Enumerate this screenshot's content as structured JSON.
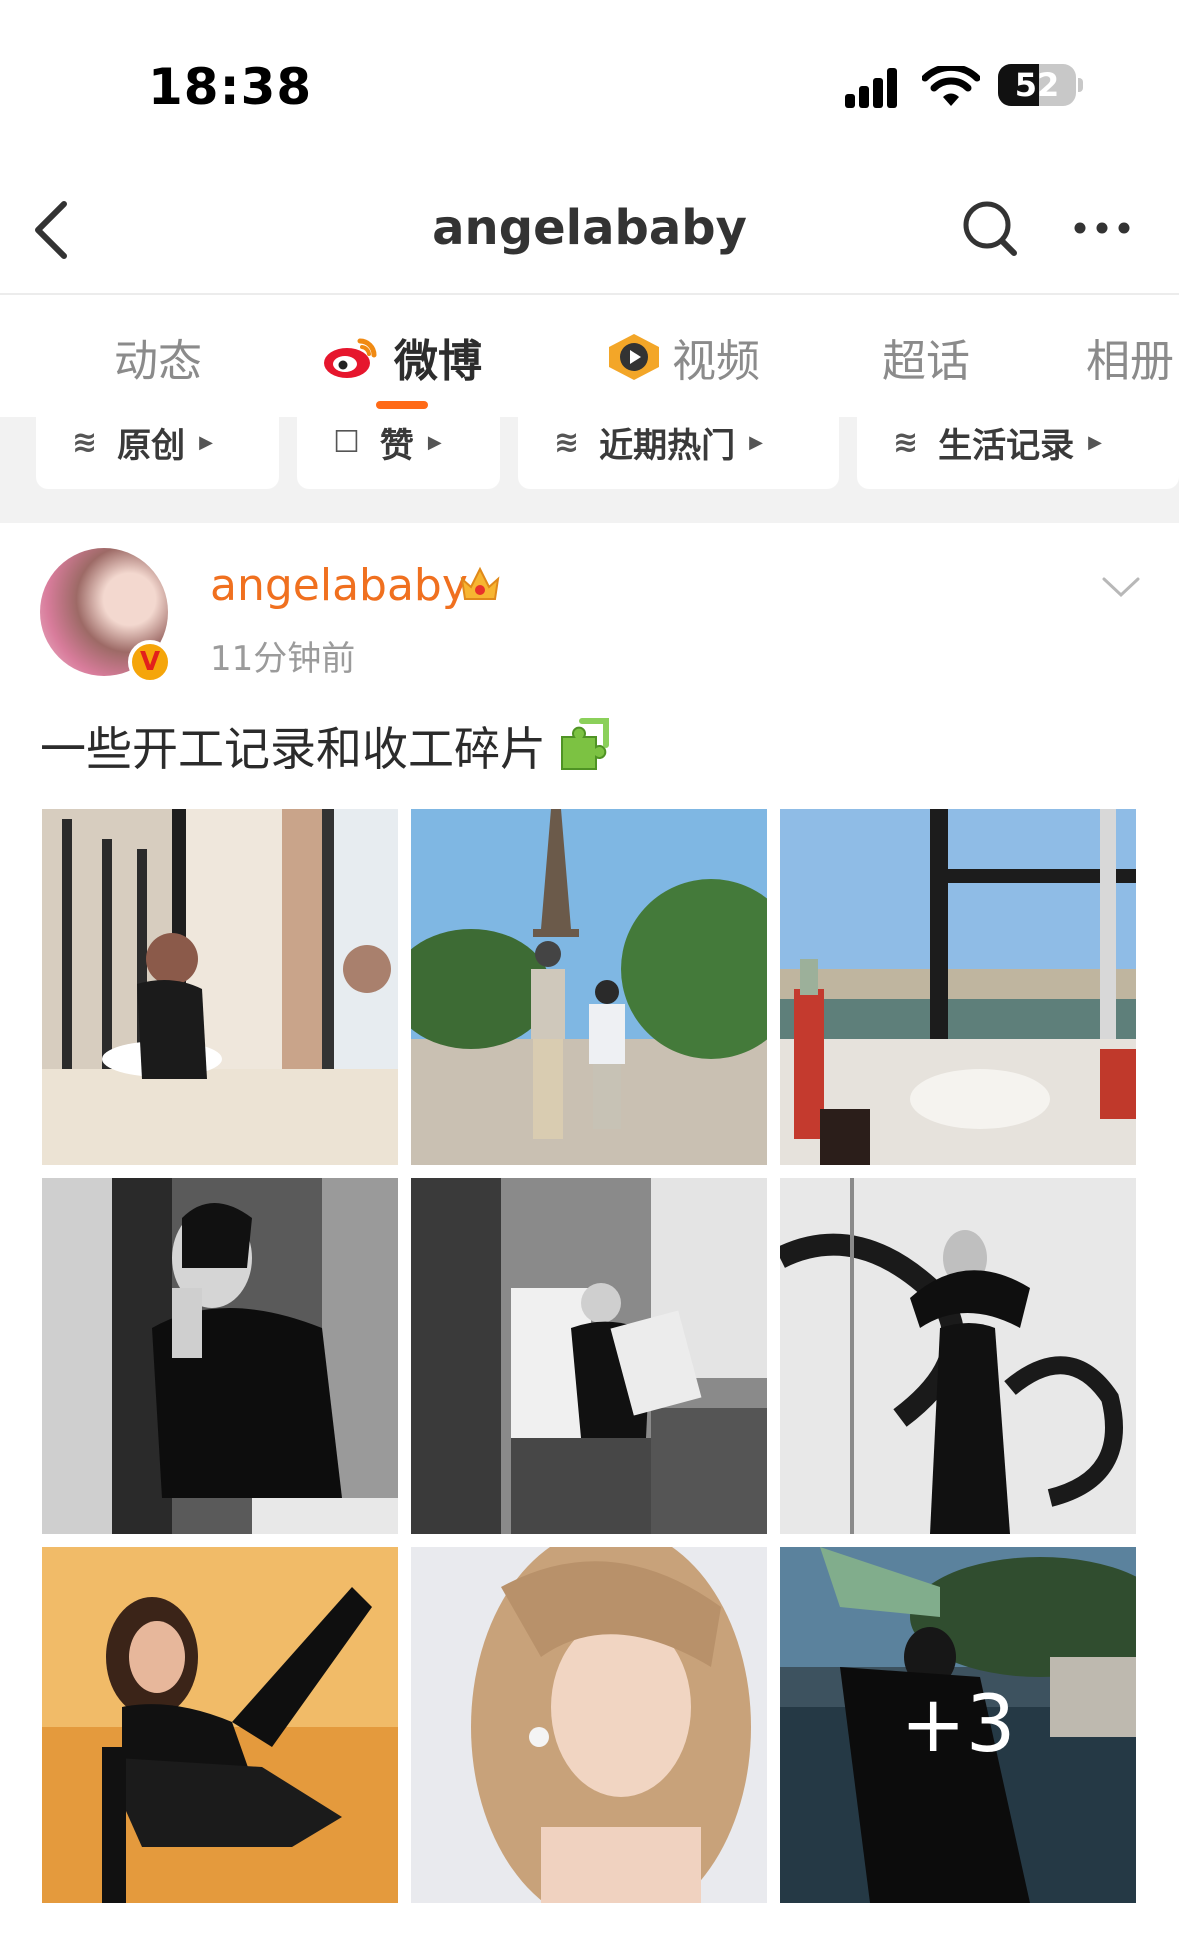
{
  "status_bar": {
    "time": "18:38",
    "battery": "52",
    "battery_level": 0.52
  },
  "nav": {
    "title": "angelababy",
    "back_icon": "chevron-left-icon",
    "search_icon": "search-icon",
    "more_icon": "more-icon"
  },
  "tabs": [
    {
      "label": "动态",
      "active": false
    },
    {
      "label": "微博",
      "active": true,
      "icon": "weibo-logo-icon"
    },
    {
      "label": "视频",
      "active": false,
      "icon": "video-play-icon"
    },
    {
      "label": "超话",
      "active": false
    },
    {
      "label": "相册",
      "active": false
    }
  ],
  "filter_chips": [
    {
      "label": "原创",
      "icon": "layers-icon"
    },
    {
      "label": "赞",
      "icon": "thumb-up-icon"
    },
    {
      "label": "近期热门",
      "icon": "layers-icon"
    },
    {
      "label": "生活记录",
      "icon": "layers-icon"
    }
  ],
  "post": {
    "username": "angelababy",
    "time": "11分钟前",
    "text": "一些开工记录和收工碎片",
    "badge": "V",
    "more_count": "+3",
    "colors": {
      "username": "#f0701f",
      "accent": "#ff6a17"
    }
  }
}
